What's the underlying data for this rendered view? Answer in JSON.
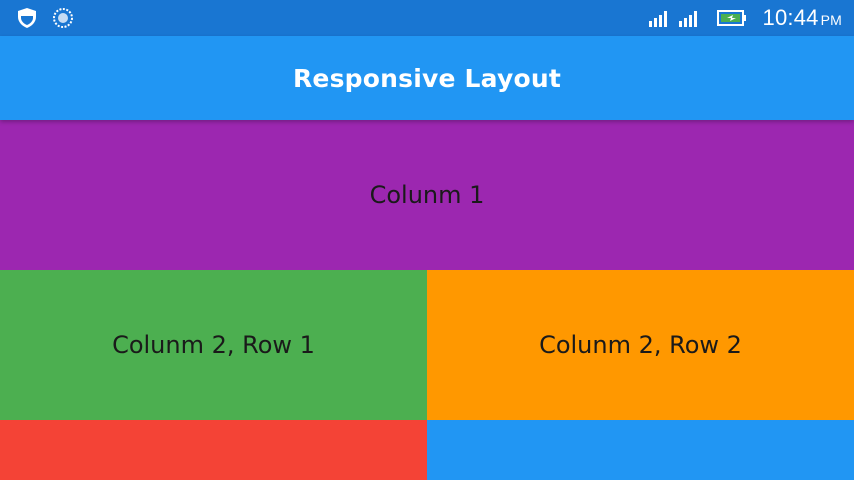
{
  "status_bar": {
    "time": "10:44",
    "ampm": "PM",
    "icons": [
      "shield-icon",
      "sync-icon",
      "signal-icon",
      "signal-icon",
      "battery-charging-icon"
    ],
    "background": "#1976D2"
  },
  "app_bar": {
    "title": "Responsive Layout",
    "background": "#2196F3"
  },
  "blocks": [
    {
      "label": "Colunm 1",
      "color": "#9C27B0"
    },
    {
      "label": "Colunm 2, Row 1",
      "color": "#4CAF50"
    },
    {
      "label": "Colunm 2, Row 2",
      "color": "#FF9800"
    },
    {
      "label": "",
      "color": "#F44336"
    },
    {
      "label": "",
      "color": "#2196F3"
    }
  ]
}
